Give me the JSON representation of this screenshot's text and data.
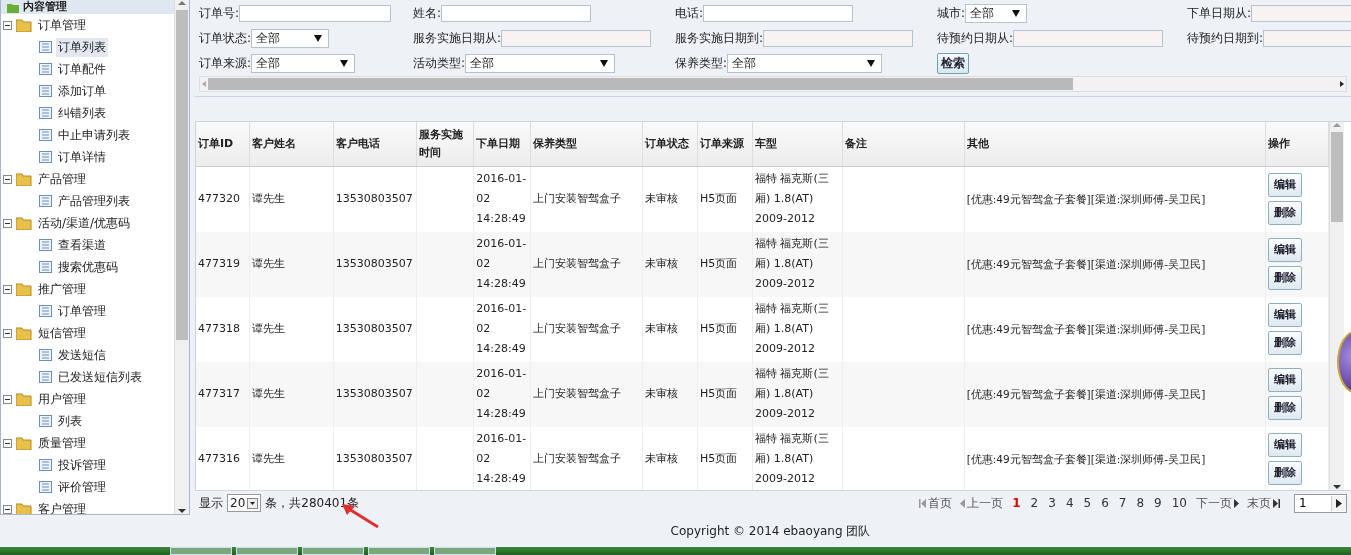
{
  "sidebar": {
    "title": "内容管理",
    "groups": [
      {
        "label": "订单管理",
        "expanded": true,
        "children": [
          {
            "label": "订单列表",
            "selected": true
          },
          {
            "label": "订单配件",
            "selected": false
          },
          {
            "label": "添加订单",
            "selected": false
          },
          {
            "label": "纠错列表",
            "selected": false
          },
          {
            "label": "中止申请列表",
            "selected": false
          },
          {
            "label": "订单详情",
            "selected": false
          }
        ]
      },
      {
        "label": "产品管理",
        "expanded": true,
        "children": [
          {
            "label": "产品管理列表",
            "selected": false
          }
        ]
      },
      {
        "label": "活动/渠道/优惠码",
        "expanded": true,
        "children": [
          {
            "label": "查看渠道",
            "selected": false
          },
          {
            "label": "搜索优惠码",
            "selected": false
          }
        ]
      },
      {
        "label": "推广管理",
        "expanded": true,
        "children": [
          {
            "label": "订单管理",
            "selected": false
          }
        ]
      },
      {
        "label": "短信管理",
        "expanded": true,
        "children": [
          {
            "label": "发送短信",
            "selected": false
          },
          {
            "label": "已发送短信列表",
            "selected": false
          }
        ]
      },
      {
        "label": "用户管理",
        "expanded": true,
        "children": [
          {
            "label": "列表",
            "selected": false
          }
        ]
      },
      {
        "label": "质量管理",
        "expanded": true,
        "children": [
          {
            "label": "投诉管理",
            "selected": false
          },
          {
            "label": "评价管理",
            "selected": false
          }
        ]
      },
      {
        "label": "客户管理",
        "expanded": true
      }
    ]
  },
  "filter_rows": [
    [
      {
        "kind": "input",
        "label": "订单号:"
      },
      {
        "kind": "input",
        "label": "姓名:"
      },
      {
        "kind": "input",
        "label": "电话:"
      },
      {
        "kind": "select",
        "label": "城市:",
        "value": "全部"
      },
      {
        "kind": "date",
        "label": "下单日期从:"
      }
    ],
    [
      {
        "kind": "select",
        "label": "订单状态:",
        "value": "全部"
      },
      {
        "kind": "date",
        "label": "服务实施日期从:"
      },
      {
        "kind": "date",
        "label": "服务实施日期到:"
      },
      {
        "kind": "date",
        "label": "待预约日期从:"
      },
      {
        "kind": "date",
        "label": "待预约日期到:"
      }
    ],
    [
      {
        "kind": "select",
        "label": "订单来源:",
        "value": "全部"
      },
      {
        "kind": "select",
        "label": "活动类型:",
        "value": "全部"
      },
      {
        "kind": "select",
        "label": "保养类型:",
        "value": "全部"
      },
      {
        "kind": "button",
        "label": "检索"
      }
    ]
  ],
  "table": {
    "columns": [
      "订单ID",
      "客户姓名",
      "客户电话",
      "服务实施时间",
      "下单日期",
      "保养类型",
      "订单状态",
      "订单来源",
      "车型",
      "备注",
      "其他",
      "操作"
    ],
    "rows": [
      {
        "order_id": "477320",
        "customer_name": "谭先生",
        "customer_phone": "13530803507",
        "order_date": "2016-01-02 14:28:49",
        "maintenance_type": "上门安装智驾盒子",
        "order_status": "未审核",
        "order_source": "H5页面",
        "car_model": "福特 福克斯(三厢) 1.8(AT) 2009-2012",
        "other": "[优惠:49元智驾盒子套餐][渠道:深圳师傅-吴卫民]",
        "actions": [
          "编辑",
          "删除"
        ]
      },
      {
        "order_id": "477319",
        "customer_name": "谭先生",
        "customer_phone": "13530803507",
        "order_date": "2016-01-02 14:28:49",
        "maintenance_type": "上门安装智驾盒子",
        "order_status": "未审核",
        "order_source": "H5页面",
        "car_model": "福特 福克斯(三厢) 1.8(AT) 2009-2012",
        "other": "[优惠:49元智驾盒子套餐][渠道:深圳师傅-吴卫民]",
        "actions": [
          "编辑",
          "删除"
        ]
      },
      {
        "order_id": "477318",
        "customer_name": "谭先生",
        "customer_phone": "13530803507",
        "order_date": "2016-01-02 14:28:49",
        "maintenance_type": "上门安装智驾盒子",
        "order_status": "未审核",
        "order_source": "H5页面",
        "car_model": "福特 福克斯(三厢) 1.8(AT) 2009-2012",
        "other": "[优惠:49元智驾盒子套餐][渠道:深圳师傅-吴卫民]",
        "actions": [
          "编辑",
          "删除"
        ]
      },
      {
        "order_id": "477317",
        "customer_name": "谭先生",
        "customer_phone": "13530803507",
        "order_date": "2016-01-02 14:28:49",
        "maintenance_type": "上门安装智驾盒子",
        "order_status": "未审核",
        "order_source": "H5页面",
        "car_model": "福特 福克斯(三厢) 1.8(AT) 2009-2012",
        "other": "[优惠:49元智驾盒子套餐][渠道:深圳师傅-吴卫民]",
        "actions": [
          "编辑",
          "删除"
        ]
      },
      {
        "order_id": "477316",
        "customer_name": "谭先生",
        "customer_phone": "13530803507",
        "order_date": "2016-01-02 14:28:49",
        "maintenance_type": "上门安装智驾盒子",
        "order_status": "未审核",
        "order_source": "H5页面",
        "car_model": "福特 福克斯(三厢) 1.8(AT) 2009-2012",
        "other": "[优惠:49元智驾盒子套餐][渠道:深圳师傅-吴卫民]",
        "actions": [
          "编辑",
          "删除"
        ]
      }
    ]
  },
  "pager": {
    "show_label": "显示",
    "page_size": "20",
    "total": "条，共280401条",
    "first": "首页",
    "previous": "上一页",
    "pages": [
      {
        "label": "1",
        "selected": true
      },
      {
        "label": "2",
        "selected": false
      },
      {
        "label": "3",
        "selected": false
      },
      {
        "label": "4",
        "selected": false
      },
      {
        "label": "5",
        "selected": false
      },
      {
        "label": "6",
        "selected": false
      },
      {
        "label": "7",
        "selected": false
      },
      {
        "label": "8",
        "selected": false
      },
      {
        "label": "9",
        "selected": false
      },
      {
        "label": "10",
        "selected": false
      }
    ],
    "next": "下一页",
    "last": "末页",
    "page_input": "1"
  },
  "footer": {
    "copyright": "Copyright © 2014 ebaoyang 团队"
  }
}
